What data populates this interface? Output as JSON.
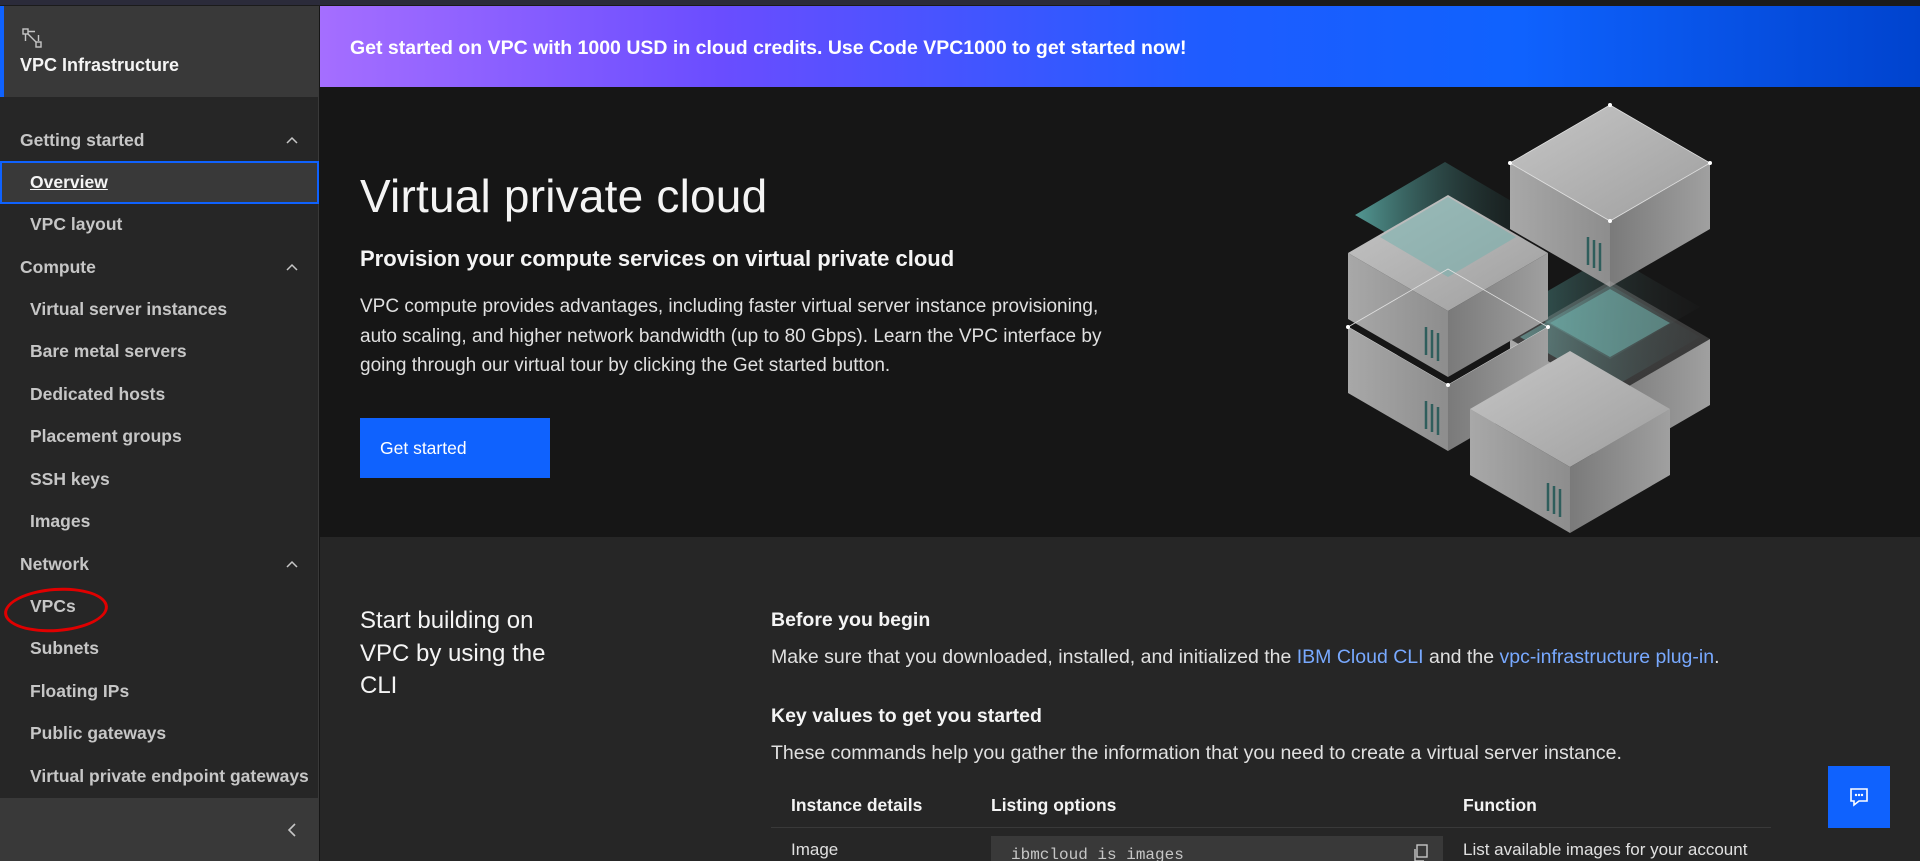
{
  "sidebar": {
    "title": "VPC Infrastructure",
    "sections": [
      {
        "label": "Getting started",
        "items": [
          "Overview",
          "VPC layout"
        ]
      },
      {
        "label": "Compute",
        "items": [
          "Virtual server instances",
          "Bare metal servers",
          "Dedicated hosts",
          "Placement groups",
          "SSH keys",
          "Images"
        ]
      },
      {
        "label": "Network",
        "items": [
          "VPCs",
          "Subnets",
          "Floating IPs",
          "Public gateways",
          "Virtual private endpoint gateways"
        ]
      }
    ],
    "active_item": "Overview",
    "highlighted_item": "VPCs"
  },
  "banner": {
    "text": "Get started on VPC with 1000 USD in cloud credits. Use Code VPC1000 to get started now!"
  },
  "hero": {
    "title": "Virtual private cloud",
    "subtitle": "Provision your compute services on virtual private cloud",
    "description": "VPC compute provides advantages, including faster virtual server instance provisioning, auto scaling, and higher network bandwidth (up to 80 Gbps). Learn the VPC interface by going through our virtual tour by clicking the Get started button.",
    "cta_label": "Get started"
  },
  "cli": {
    "lead": "Start building on VPC by using the CLI",
    "before_title": "Before you begin",
    "before_prefix": "Make sure that you downloaded, installed, and initialized the ",
    "link_cli": "IBM Cloud CLI",
    "before_middle": " and the ",
    "link_plugin": "vpc-infrastructure plug-in",
    "before_suffix": ".",
    "key_values_title": "Key values to get you started",
    "key_values_desc": "These commands help you gather the information that you need to create a virtual server instance.",
    "table": {
      "headers": [
        "Instance details",
        "Listing options",
        "Function"
      ],
      "rows": [
        {
          "detail": "Image",
          "command": "ibmcloud is images",
          "function": "List available images for your account"
        }
      ]
    }
  },
  "colors": {
    "accent": "#0f62fe",
    "link": "#78a9ff",
    "annotation": "#e00000"
  },
  "icons": [
    "vpc-logo-icon",
    "chevron-up-icon",
    "chevron-left-icon",
    "copy-icon",
    "chat-icon"
  ]
}
